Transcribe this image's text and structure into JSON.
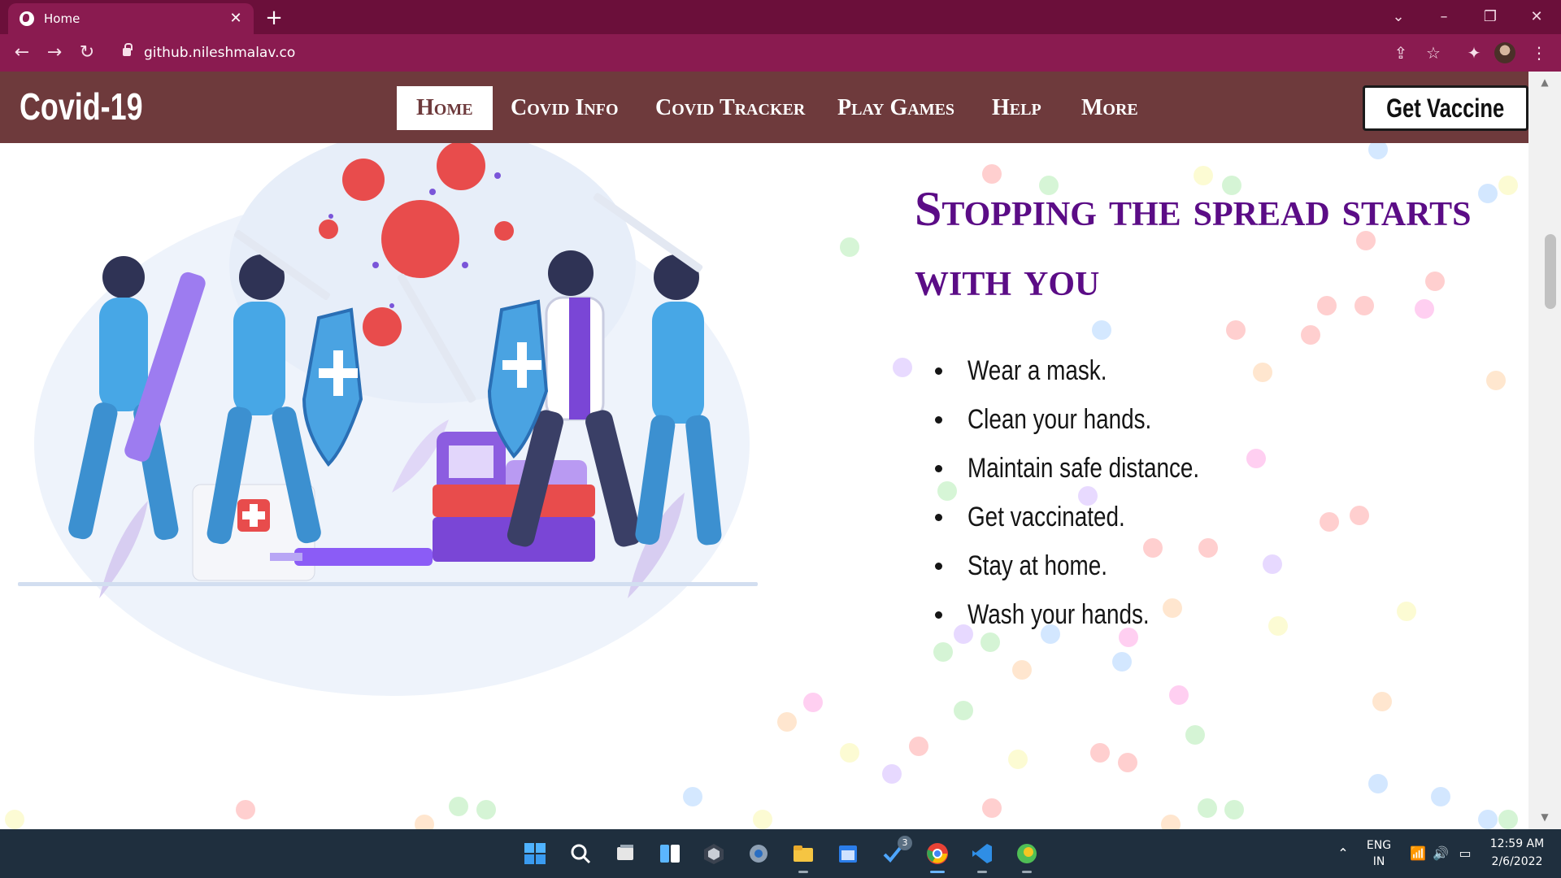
{
  "browser": {
    "tab_title": "Home",
    "tab_close": "✕",
    "new_tab": "+",
    "url": "github.nileshmalav.co",
    "window_controls": {
      "tab_search": "⌄",
      "minimize": "–",
      "restore": "❐",
      "close": "✕"
    },
    "nav": {
      "back": "←",
      "forward": "→",
      "reload": "↻"
    },
    "toolbar_icons": {
      "share": "⇪",
      "bookmark": "☆",
      "extensions": "✦",
      "menu": "⋮"
    },
    "icons": [
      "globe-icon",
      "lock-icon",
      "share-icon",
      "star-icon",
      "puzzle-icon",
      "profile-avatar",
      "kebab-menu-icon"
    ],
    "accent": "#8a1b50"
  },
  "site": {
    "brand": "Covid-19",
    "nav_items": [
      "Home",
      "Covid Info",
      "Covid Tracker",
      "Play Games",
      "Help",
      "More"
    ],
    "active_nav": "Home",
    "cta": "Get Vaccine",
    "navbar_color": "#6e3a3c"
  },
  "hero": {
    "headline": "Stopping the spread starts with you",
    "headline_color": "#5b0c86",
    "tips": [
      "Wear a mask.",
      "Clean your hands.",
      "Maintain safe distance.",
      "Get vaccinated.",
      "Stay at home.",
      "Wash your hands."
    ]
  },
  "scrollbar": {
    "up": "▲",
    "down": "▼"
  },
  "taskbar": {
    "apps": [
      "windows-start-icon",
      "search-icon",
      "task-view-icon",
      "widgets-icon",
      "github-desktop-icon",
      "settings-icon",
      "file-explorer-icon",
      "calendar-icon",
      "todo-icon",
      "chrome-icon",
      "vscode-icon",
      "edge-canary-icon"
    ],
    "todo_badge": "3",
    "language_top": "ENG",
    "language_bottom": "IN",
    "time": "12:59 AM",
    "date": "2/6/2022",
    "tray": {
      "chevron": "⌃",
      "wifi": "📶",
      "volume": "🔊",
      "battery": "▭"
    },
    "bg": "#1f2f3e"
  }
}
